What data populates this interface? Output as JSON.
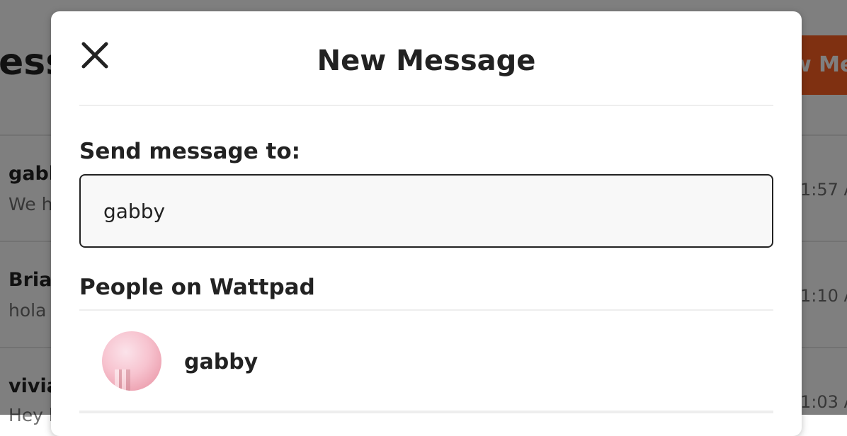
{
  "background": {
    "page_title": "ess",
    "new_button_label": "w Me",
    "conversations": [
      {
        "name": "gabb",
        "preview": "We ha",
        "time": "1:57 A"
      },
      {
        "name": "Brian",
        "preview": "hola",
        "time": "1:10 A"
      },
      {
        "name": "vivia",
        "preview": "Hey h",
        "time": "1:03 A"
      }
    ]
  },
  "modal": {
    "title": "New Message",
    "close_icon": "close-icon",
    "field_label": "Send message to:",
    "recipient_value": "gabby",
    "results_heading": "People on Wattpad",
    "results": [
      {
        "name": "gabby"
      }
    ]
  },
  "colors": {
    "accent": "#ff6122",
    "overlay": "rgba(0,0,0,0.5)",
    "text": "#222222"
  }
}
